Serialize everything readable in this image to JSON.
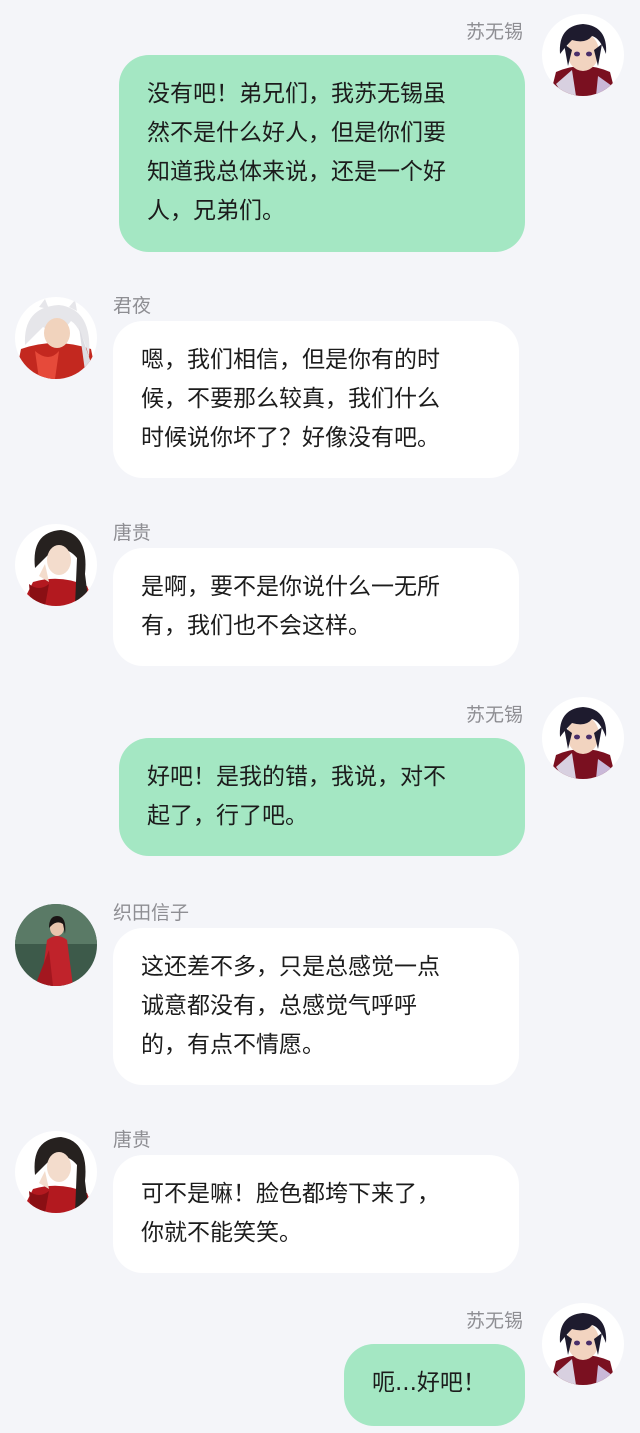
{
  "messages": [
    {
      "sender": "苏无锡",
      "text": "没有吧！弟兄们，我苏无锡虽\n然不是什么好人，但是你们要\n知道我总体来说，还是一个好\n人，兄弟们。"
    },
    {
      "sender": "君夜",
      "text": "嗯，我们相信，但是你有的时\n候，不要那么较真，我们什么\n时候说你坏了？好像没有吧。"
    },
    {
      "sender": "唐贵",
      "text": "是啊，要不是你说什么一无所\n有，我们也不会这样。"
    },
    {
      "sender": "苏无锡",
      "text": "好吧！是我的错，我说，对不\n起了，行了吧。"
    },
    {
      "sender": "织田信子",
      "text": "这还差不多，只是总感觉一点\n诚意都没有，总感觉气呼呼\n的，有点不情愿。"
    },
    {
      "sender": "唐贵",
      "text": "可不是嘛！脸色都垮下来了，\n你就不能笑笑。"
    },
    {
      "sender": "苏无锡",
      "text": "呃...好吧！"
    }
  ]
}
